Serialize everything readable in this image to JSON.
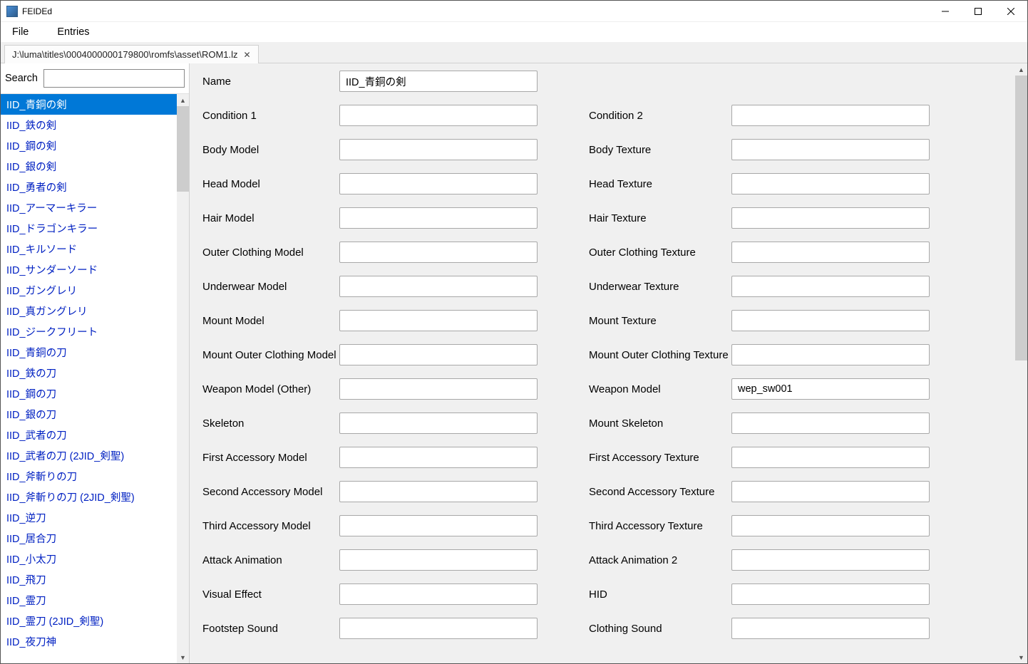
{
  "window": {
    "title": "FEIDEd"
  },
  "menu": {
    "file": "File",
    "entries": "Entries"
  },
  "tab": {
    "label": "J:\\luma\\titles\\0004000000179800\\romfs\\asset\\ROM1.lz"
  },
  "sidebar": {
    "search_label": "Search",
    "search_value": "",
    "items": [
      "IID_青銅の剣",
      "IID_鉄の剣",
      "IID_鋼の剣",
      "IID_銀の剣",
      "IID_勇者の剣",
      "IID_アーマーキラー",
      "IID_ドラゴンキラー",
      "IID_キルソード",
      "IID_サンダーソード",
      "IID_ガングレリ",
      "IID_真ガングレリ",
      "IID_ジークフリート",
      "IID_青銅の刀",
      "IID_鉄の刀",
      "IID_鋼の刀",
      "IID_銀の刀",
      "IID_武者の刀",
      "IID_武者の刀 (2JID_剣聖)",
      "IID_斧斬りの刀",
      "IID_斧斬りの刀 (2JID_剣聖)",
      "IID_逆刀",
      "IID_居合刀",
      "IID_小太刀",
      "IID_飛刀",
      "IID_霊刀",
      "IID_霊刀 (2JID_剣聖)",
      "IID_夜刀神"
    ],
    "selected_index": 0
  },
  "form": {
    "rows": [
      {
        "l1": "Name",
        "v1": "IID_青銅の剣",
        "l2": "",
        "v2": "",
        "single": true
      },
      {
        "l1": "Condition 1",
        "v1": "",
        "l2": "Condition 2",
        "v2": ""
      },
      {
        "l1": "Body Model",
        "v1": "",
        "l2": "Body Texture",
        "v2": ""
      },
      {
        "l1": "Head Model",
        "v1": "",
        "l2": "Head Texture",
        "v2": ""
      },
      {
        "l1": "Hair Model",
        "v1": "",
        "l2": "Hair Texture",
        "v2": ""
      },
      {
        "l1": "Outer Clothing Model",
        "v1": "",
        "l2": "Outer Clothing Texture",
        "v2": ""
      },
      {
        "l1": "Underwear Model",
        "v1": "",
        "l2": "Underwear Texture",
        "v2": ""
      },
      {
        "l1": "Mount Model",
        "v1": "",
        "l2": "Mount Texture",
        "v2": ""
      },
      {
        "l1": "Mount Outer Clothing Model",
        "v1": "",
        "l2": "Mount Outer Clothing Texture",
        "v2": ""
      },
      {
        "l1": "Weapon Model (Other)",
        "v1": "",
        "l2": "Weapon Model",
        "v2": "wep_sw001"
      },
      {
        "l1": "Skeleton",
        "v1": "",
        "l2": "Mount Skeleton",
        "v2": ""
      },
      {
        "l1": "First Accessory Model",
        "v1": "",
        "l2": "First Accessory Texture",
        "v2": ""
      },
      {
        "l1": "Second Accessory Model",
        "v1": "",
        "l2": "Second Accessory Texture",
        "v2": ""
      },
      {
        "l1": "Third Accessory Model",
        "v1": "",
        "l2": "Third Accessory Texture",
        "v2": ""
      },
      {
        "l1": "Attack Animation",
        "v1": "",
        "l2": "Attack Animation 2",
        "v2": ""
      },
      {
        "l1": "Visual Effect",
        "v1": "",
        "l2": "HID",
        "v2": ""
      },
      {
        "l1": "Footstep Sound",
        "v1": "",
        "l2": "Clothing Sound",
        "v2": ""
      }
    ]
  }
}
